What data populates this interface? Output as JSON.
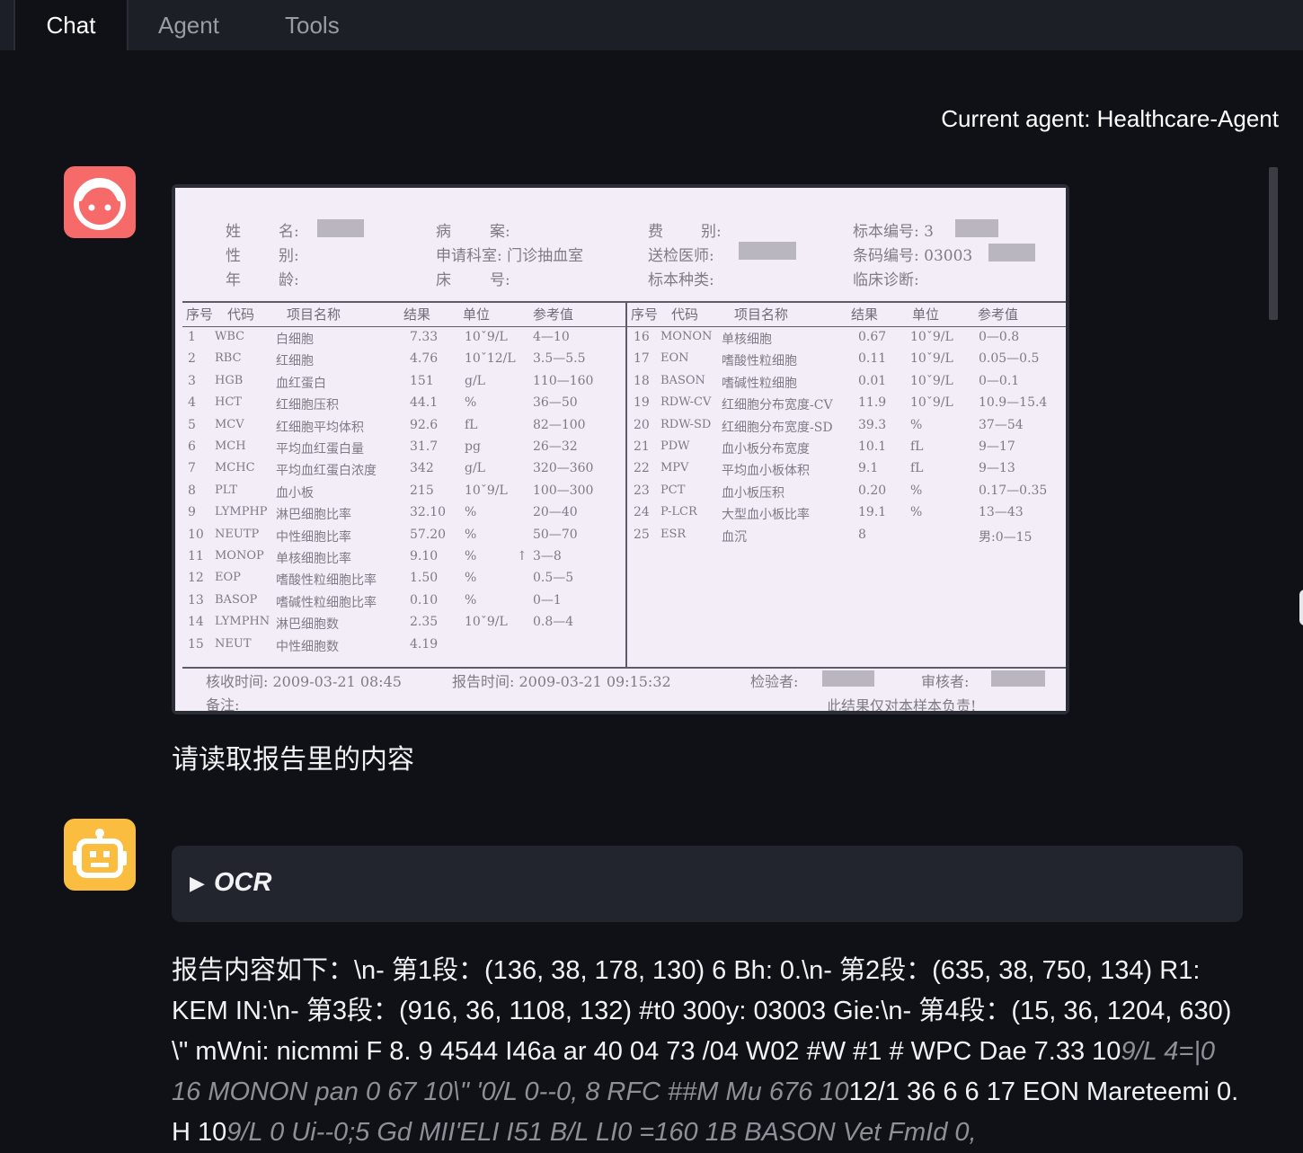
{
  "tabs": [
    "Chat",
    "Agent",
    "Tools"
  ],
  "current_agent": "Current agent: Healthcare-Agent",
  "report": {
    "header": [
      [
        "姓",
        "名:",
        "病",
        "案:",
        "费",
        "别:",
        "标本编号: 3"
      ],
      [
        "性",
        "别:",
        "申请科室: 门诊抽血室",
        "",
        "送检医师:",
        "",
        "条码编号: 03003"
      ],
      [
        "年",
        "龄:",
        "床",
        "号:",
        "标本种类:",
        "",
        "临床诊断:"
      ]
    ],
    "columns": [
      "序号",
      "代码",
      "项目名称",
      "结果",
      "单位",
      "参考值"
    ],
    "left_rows": [
      [
        "1",
        "WBC",
        "白细胞",
        "7.33",
        "10ˇ9/L",
        "4—10",
        ""
      ],
      [
        "2",
        "RBC",
        "红细胞",
        "4.76",
        "10ˇ12/L",
        "3.5—5.5",
        ""
      ],
      [
        "3",
        "HGB",
        "血红蛋白",
        "151",
        "g/L",
        "110—160",
        ""
      ],
      [
        "4",
        "HCT",
        "红细胞压积",
        "44.1",
        "%",
        "36—50",
        ""
      ],
      [
        "5",
        "MCV",
        "红细胞平均体积",
        "92.6",
        "fL",
        "82—100",
        ""
      ],
      [
        "6",
        "MCH",
        "平均血红蛋白量",
        "31.7",
        "pg",
        "26—32",
        ""
      ],
      [
        "7",
        "MCHC",
        "平均血红蛋白浓度",
        "342",
        "g/L",
        "320—360",
        ""
      ],
      [
        "8",
        "PLT",
        "血小板",
        "215",
        "10ˇ9/L",
        "100—300",
        ""
      ],
      [
        "9",
        "LYMPHP",
        "淋巴细胞比率",
        "32.10",
        "%",
        "20—40",
        ""
      ],
      [
        "10",
        "NEUTP",
        "中性细胞比率",
        "57.20",
        "%",
        "50—70",
        ""
      ],
      [
        "11",
        "MONOP",
        "单核细胞比率",
        "9.10",
        "%",
        "3—8",
        "↑"
      ],
      [
        "12",
        "EOP",
        "嗜酸性粒细胞比率",
        "1.50",
        "%",
        "0.5—5",
        ""
      ],
      [
        "13",
        "BASOP",
        "嗜碱性粒细胞比率",
        "0.10",
        "%",
        "0—1",
        ""
      ],
      [
        "14",
        "LYMPHN",
        "淋巴细胞数",
        "2.35",
        "10ˇ9/L",
        "0.8—4",
        ""
      ],
      [
        "15",
        "NEUT",
        "中性细胞数",
        "4.19",
        "",
        "",
        ""
      ]
    ],
    "right_rows": [
      [
        "16",
        "MONON",
        "单核细胞",
        "0.67",
        "10ˇ9/L",
        "0—0.8"
      ],
      [
        "17",
        "EON",
        "嗜酸性粒细胞",
        "0.11",
        "10ˇ9/L",
        "0.05—0.5"
      ],
      [
        "18",
        "BASON",
        "嗜碱性粒细胞",
        "0.01",
        "10ˇ9/L",
        "0—0.1"
      ],
      [
        "19",
        "RDW-CV",
        "红细胞分布宽度-CV",
        "11.9",
        "10ˇ9/L",
        "10.9—15.4"
      ],
      [
        "20",
        "RDW-SD",
        "红细胞分布宽度-SD",
        "39.3",
        "%",
        "37—54"
      ],
      [
        "21",
        "PDW",
        "血小板分布宽度",
        "10.1",
        "fL",
        "9—17"
      ],
      [
        "22",
        "MPV",
        "平均血小板体积",
        "9.1",
        "fL",
        "9—13"
      ],
      [
        "23",
        "PCT",
        "血小板压积",
        "0.20",
        "%",
        "0.17—0.35"
      ],
      [
        "24",
        "P-LCR",
        "大型血小板比率",
        "19.1",
        "%",
        "13—43"
      ],
      [
        "25",
        "ESR",
        "血沉",
        "8",
        "",
        "男:0—15"
      ]
    ],
    "footer": {
      "receive": "核收时间: 2009-03-21 08:45",
      "report": "报告时间: 2009-03-21 09:15:32",
      "inspector": "检验者:",
      "reviewer": "审核者:",
      "note": "备注:",
      "disclaimer": "此结果仅对本样本负责!"
    }
  },
  "user_message": "请读取报告里的内容",
  "ocr_label": "OCR",
  "answer": {
    "p1": "报告内容如下：\\n- 第1段：(136, 38, 178, 130) 6 Bh: 0.\\n- 第2段：(635, 38, 750, 134) R1: KEM IN:\\n- 第3段：(916, 36, 1108, 132) #t0 300y: 03003 Gie:\\n- 第4段：(15, 36, 1204, 630) \\\" mWni: nicmmi F 8. 9 4544 I46a ar 40 04 73 /04 W02 #W #1 # WPC Dae 7.33 10",
    "i1": "9/L 4=|0 16 MONON pan 0 67 10\\\" '0/L 0--0, 8 RFC ##M Mu 676 10",
    "p2": "12/1 36 6 6 17 EON Mareteemi 0. H 10",
    "i2": "9/L 0 Ui--0;5 Gd MII'ELI I51 B/L LI0 =160 1B BASON Vet FmId 0,"
  }
}
